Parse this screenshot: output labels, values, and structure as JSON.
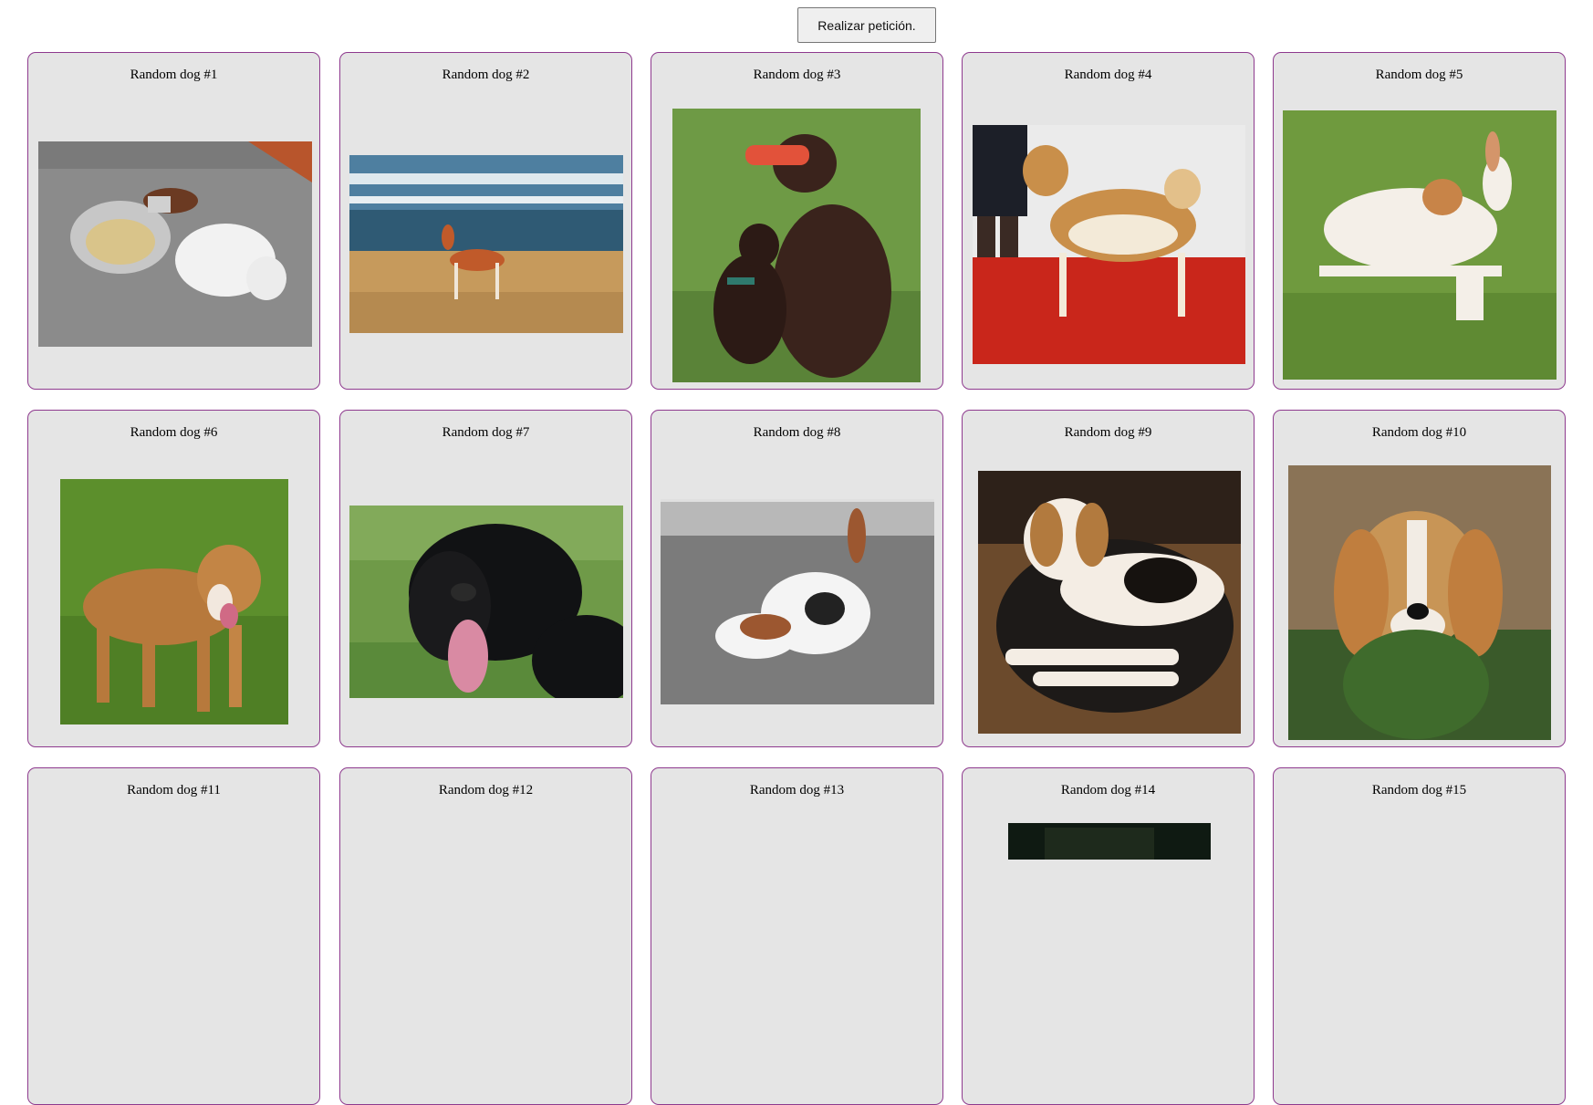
{
  "toolbar": {
    "request_button_label": "Realizar petición."
  },
  "cards": [
    {
      "title": "Random dog #1",
      "scene": "grey-floor-two-dogs"
    },
    {
      "title": "Random dog #2",
      "scene": "beach-sea-dog"
    },
    {
      "title": "Random dog #3",
      "scene": "grass-two-dark-spaniels"
    },
    {
      "title": "Random dog #4",
      "scene": "red-carpet-akita"
    },
    {
      "title": "Random dog #5",
      "scene": "grass-white-podenco"
    },
    {
      "title": "Random dog #6",
      "scene": "grass-tan-dog"
    },
    {
      "title": "Random dog #7",
      "scene": "green-black-spaniel"
    },
    {
      "title": "Random dog #8",
      "scene": "grey-floor-basset"
    },
    {
      "title": "Random dog #9",
      "scene": "rug-hound"
    },
    {
      "title": "Random dog #10",
      "scene": "bush-beagle"
    },
    {
      "title": "Random dog #11",
      "scene": "none"
    },
    {
      "title": "Random dog #12",
      "scene": "none"
    },
    {
      "title": "Random dog #13",
      "scene": "none"
    },
    {
      "title": "Random dog #14",
      "scene": "dark-partial"
    },
    {
      "title": "Random dog #15",
      "scene": "none"
    }
  ],
  "colors": {
    "card_background": "#e5e5e5",
    "card_border": "#8e3a8e",
    "button_background": "#efefef"
  }
}
